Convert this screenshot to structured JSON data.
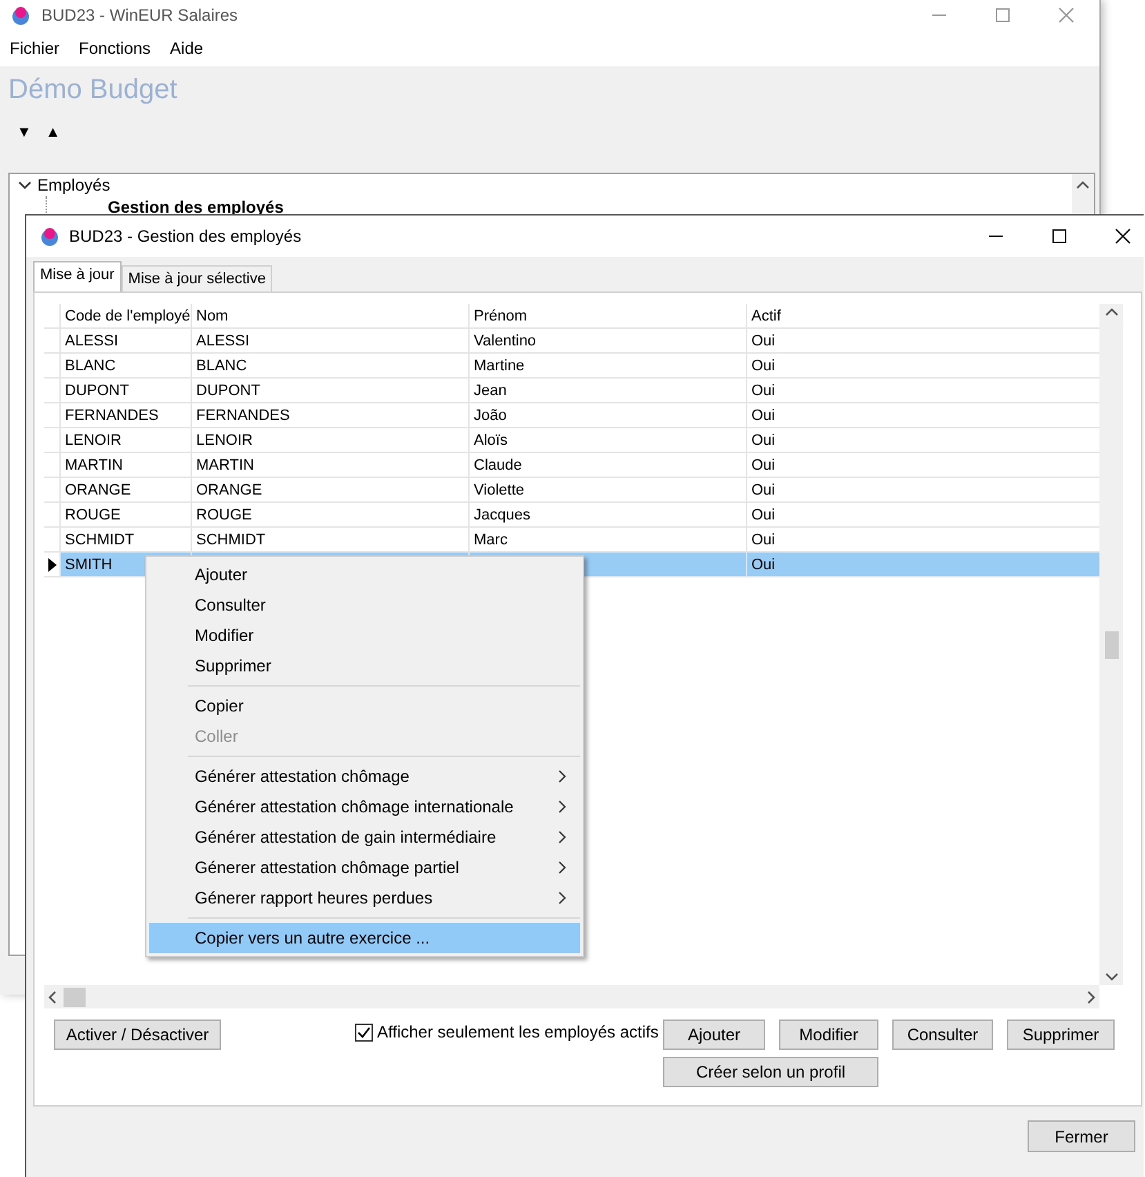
{
  "main_window": {
    "title": "BUD23 - WinEUR Salaires",
    "menu": [
      "Fichier",
      "Fonctions",
      "Aide"
    ],
    "heading": "Démo Budget",
    "sort_buttons": [
      "▼",
      "▲"
    ],
    "tree": [
      {
        "label": "Employés",
        "expanded": true,
        "children": [
          {
            "label": "Gestion des employés"
          }
        ]
      }
    ]
  },
  "dialog": {
    "title": "BUD23 - Gestion des employés",
    "tabs": [
      {
        "label": "Mise à jour",
        "selected": true
      },
      {
        "label": "Mise à jour sélective",
        "selected": false
      }
    ],
    "table": {
      "columns": [
        "Code de l'employé",
        "Nom",
        "Prénom",
        "Actif"
      ],
      "rows": [
        {
          "code": "ALESSI",
          "nom": "ALESSI",
          "prenom": "Valentino",
          "actif": "Oui",
          "selected": false
        },
        {
          "code": "BLANC",
          "nom": "BLANC",
          "prenom": "Martine",
          "actif": "Oui",
          "selected": false
        },
        {
          "code": "DUPONT",
          "nom": "DUPONT",
          "prenom": "Jean",
          "actif": "Oui",
          "selected": false
        },
        {
          "code": "FERNANDES",
          "nom": "FERNANDES",
          "prenom": "João",
          "actif": "Oui",
          "selected": false
        },
        {
          "code": "LENOIR",
          "nom": "LENOIR",
          "prenom": "Aloïs",
          "actif": "Oui",
          "selected": false
        },
        {
          "code": "MARTIN",
          "nom": "MARTIN",
          "prenom": "Claude",
          "actif": "Oui",
          "selected": false
        },
        {
          "code": "ORANGE",
          "nom": "ORANGE",
          "prenom": "Violette",
          "actif": "Oui",
          "selected": false
        },
        {
          "code": "ROUGE",
          "nom": "ROUGE",
          "prenom": "Jacques",
          "actif": "Oui",
          "selected": false
        },
        {
          "code": "SCHMIDT",
          "nom": "SCHMIDT",
          "prenom": "Marc",
          "actif": "Oui",
          "selected": false
        },
        {
          "code": "SMITH",
          "actif": "Oui",
          "selected": true
        }
      ]
    },
    "toggle_button": "Activer / Désactiver",
    "checkbox": {
      "label": "Afficher seulement les employés actifs",
      "checked": true
    },
    "action_buttons": [
      "Ajouter",
      "Modifier",
      "Consulter",
      "Supprimer",
      "Créer selon un profil"
    ],
    "close_button": "Fermer"
  },
  "context_menu": {
    "items": [
      {
        "kind": "item",
        "label": "Ajouter",
        "disabled": false,
        "submenu": false,
        "selected": false
      },
      {
        "kind": "item",
        "label": "Consulter",
        "disabled": false,
        "submenu": false,
        "selected": false
      },
      {
        "kind": "item",
        "label": "Modifier",
        "disabled": false,
        "submenu": false,
        "selected": false
      },
      {
        "kind": "item",
        "label": "Supprimer",
        "disabled": false,
        "submenu": false,
        "selected": false
      },
      {
        "kind": "separator"
      },
      {
        "kind": "item",
        "label": "Copier",
        "disabled": false,
        "submenu": false,
        "selected": false
      },
      {
        "kind": "item",
        "label": "Coller",
        "disabled": true,
        "submenu": false,
        "selected": false
      },
      {
        "kind": "separator"
      },
      {
        "kind": "item",
        "label": "Générer attestation chômage",
        "disabled": false,
        "submenu": true,
        "selected": false
      },
      {
        "kind": "item",
        "label": "Générer attestation chômage internationale",
        "disabled": false,
        "submenu": true,
        "selected": false
      },
      {
        "kind": "item",
        "label": "Générer attestation de gain intermédiaire",
        "disabled": false,
        "submenu": true,
        "selected": false
      },
      {
        "kind": "item",
        "label": "Génerer attestation chômage partiel",
        "disabled": false,
        "submenu": true,
        "selected": false
      },
      {
        "kind": "item",
        "label": "Génerer rapport heures perdues",
        "disabled": false,
        "submenu": true,
        "selected": false
      },
      {
        "kind": "separator"
      },
      {
        "kind": "item",
        "label": "Copier vers un autre exercice ...",
        "disabled": false,
        "submenu": false,
        "selected": true
      }
    ]
  }
}
